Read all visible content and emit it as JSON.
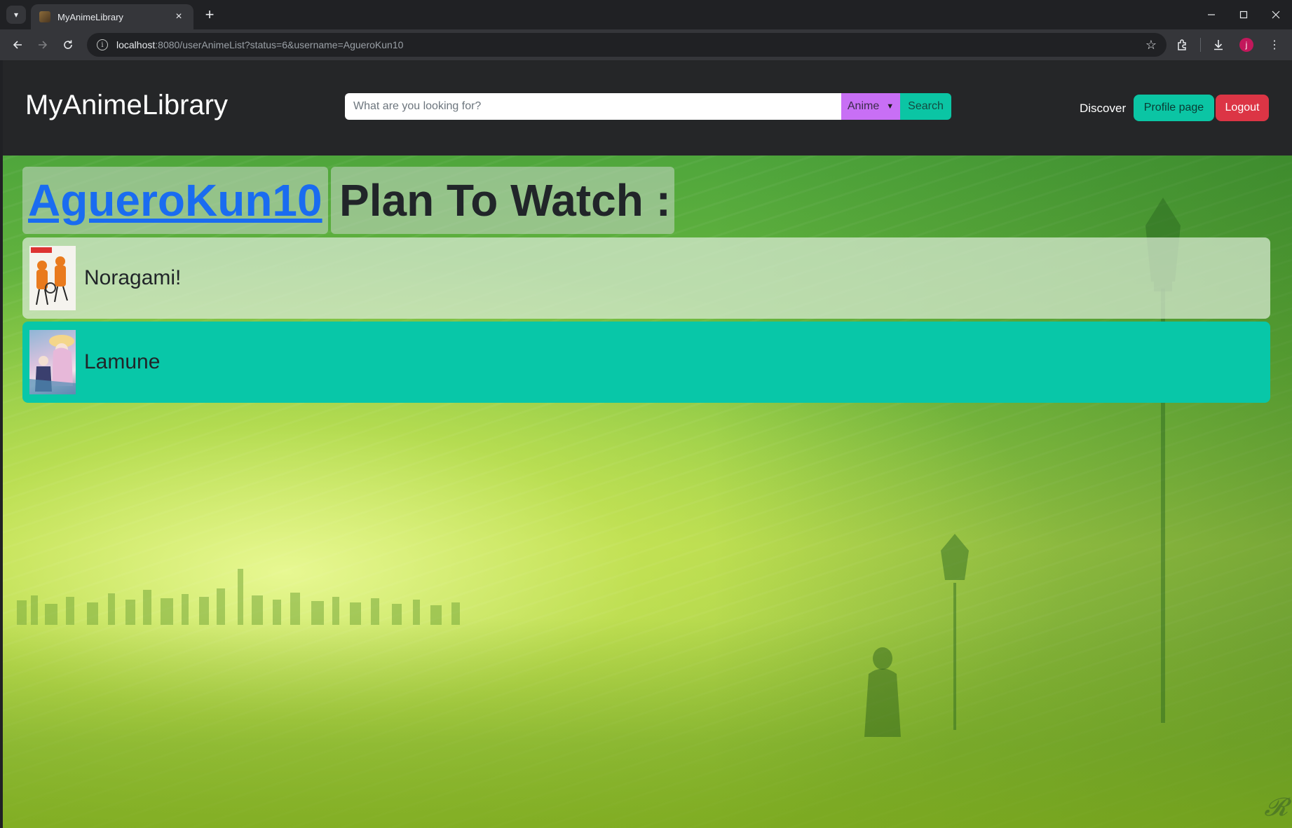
{
  "browser": {
    "tab_title": "MyAnimeLibrary",
    "url_host": "localhost",
    "url_rest": ":8080/userAnimeList?status=6&username=AgueroKun10",
    "new_tab_symbol": "+",
    "close_tab_symbol": "×",
    "profile_initial": "j"
  },
  "navbar": {
    "brand": "MyAnimeLibrary",
    "search_placeholder": "What are you looking for?",
    "search_type": "Anime",
    "search_button": "Search",
    "discover": "Discover",
    "profile_button": "Profile page",
    "logout_button": "Logout"
  },
  "heading": {
    "username": "AgueroKun10",
    "list_label": "Plan To Watch :"
  },
  "anime_list": [
    {
      "title": "Noragami!"
    },
    {
      "title": "Lamune"
    }
  ],
  "colors": {
    "teal": "#0bc5a4",
    "danger": "#dc3545",
    "select_purple": "#c86ff5",
    "link_blue": "#1a6cf0"
  }
}
